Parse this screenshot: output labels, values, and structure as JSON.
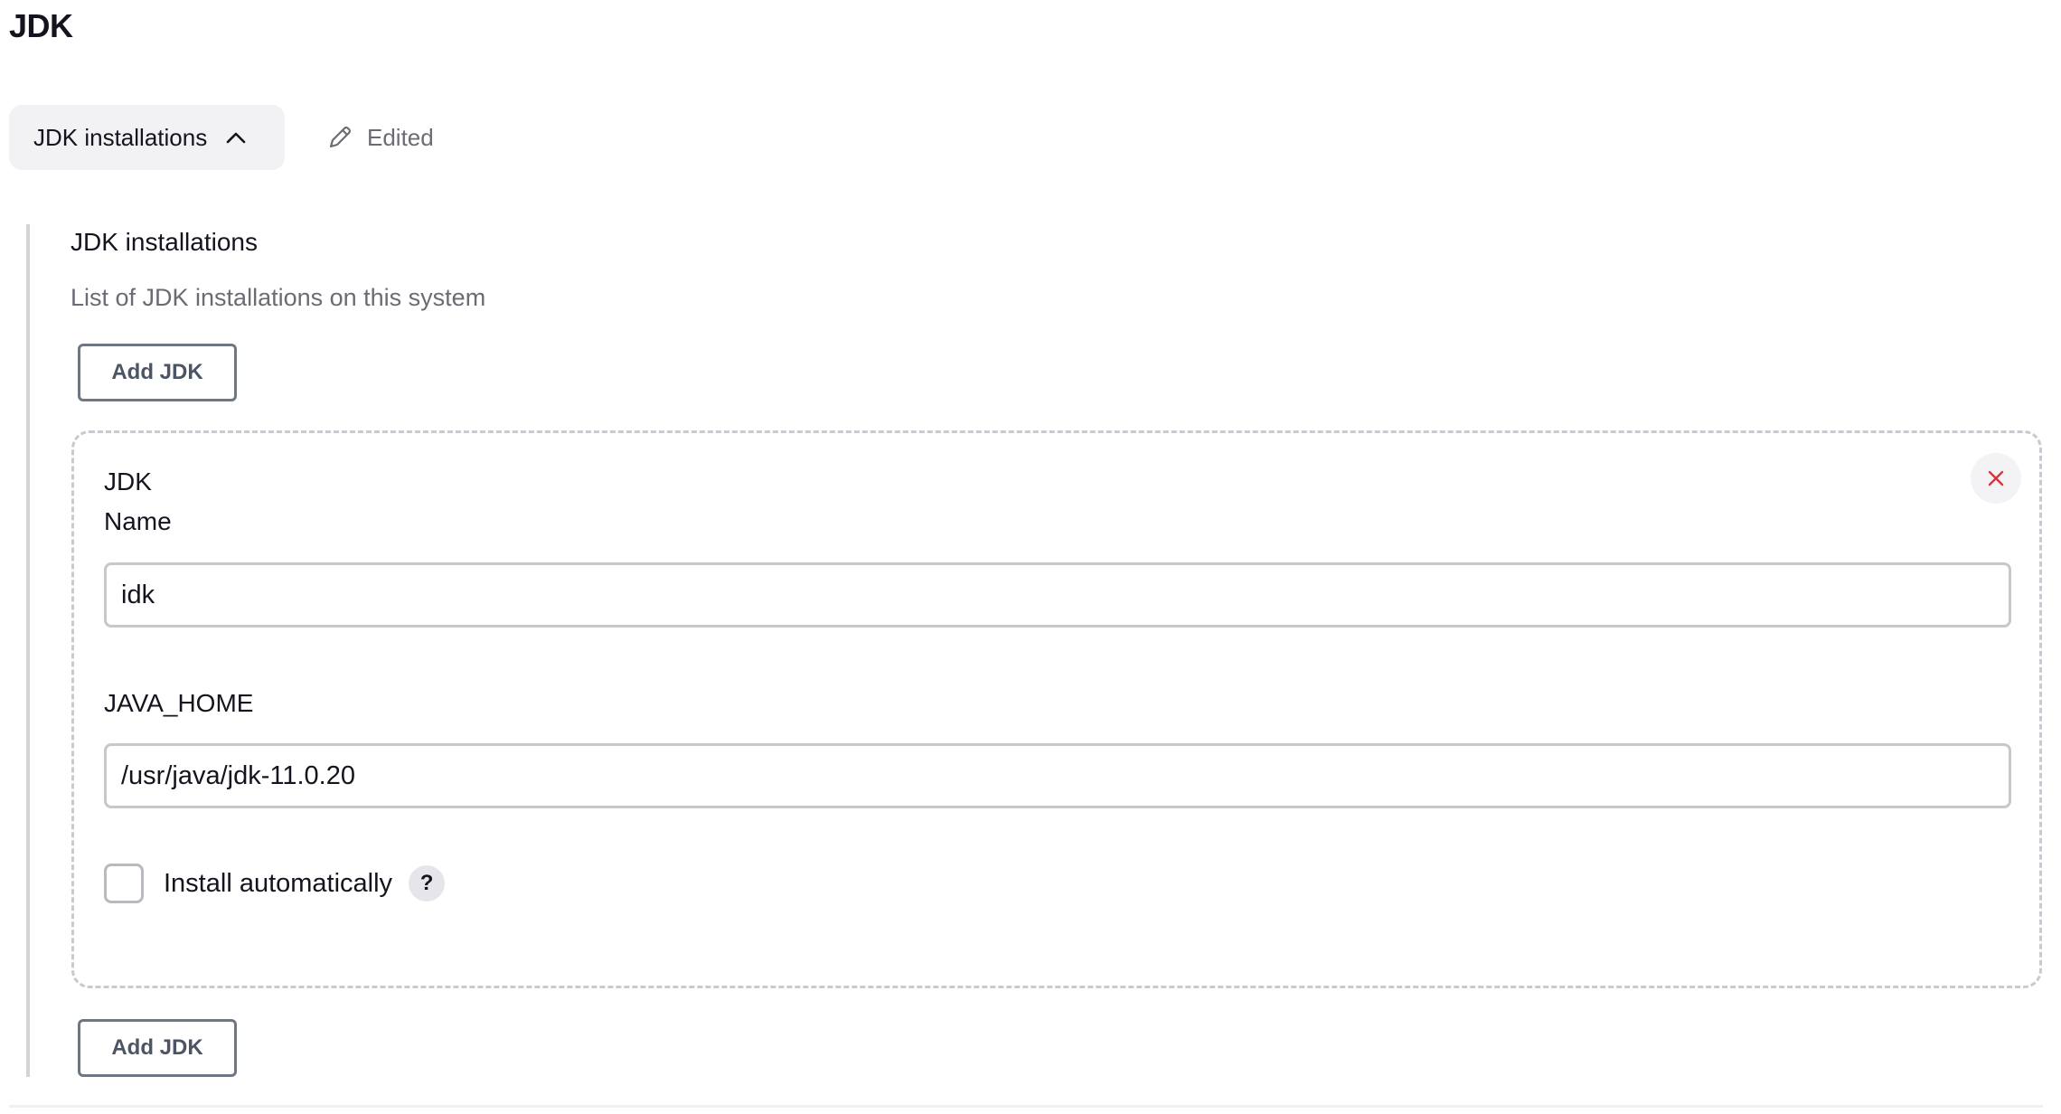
{
  "page": {
    "title": "JDK"
  },
  "section": {
    "toggle_label": "JDK installations",
    "status_label": "Edited",
    "heading": "JDK installations",
    "description": "List of JDK installations on this system",
    "add_button_label": "Add JDK"
  },
  "jdk_entry": {
    "title": "JDK",
    "name_label": "Name",
    "name_value": "idk",
    "java_home_label": "JAVA_HOME",
    "java_home_value": "/usr/java/jdk-11.0.20",
    "install_auto_label": "Install automatically",
    "install_auto_checked": false,
    "help_label": "?"
  },
  "icons": {
    "toggle": "chevron-up-icon",
    "status": "pencil-icon",
    "remove": "close-icon"
  },
  "colors": {
    "close_icon": "#d9363e",
    "muted_text": "#6b6b75",
    "button_border": "#6f7782"
  }
}
